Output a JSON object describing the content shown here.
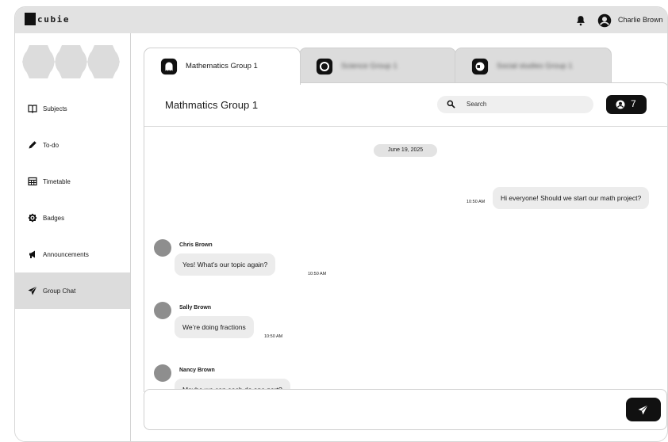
{
  "app": {
    "logo_text": "cubie"
  },
  "user": {
    "name": "Charlie Brown"
  },
  "sidebar": {
    "items": [
      {
        "label": "Subjects",
        "icon": "book-icon"
      },
      {
        "label": "To-do",
        "icon": "pencil-icon"
      },
      {
        "label": "Timetable",
        "icon": "calendar-grid-icon"
      },
      {
        "label": "Badges",
        "icon": "badge-icon"
      },
      {
        "label": "Announcements",
        "icon": "megaphone-icon"
      },
      {
        "label": "Group Chat",
        "icon": "paper-plane-icon",
        "active": true
      }
    ]
  },
  "tabs": [
    {
      "label": "Mathematics Group 1",
      "active": true
    },
    {
      "label": "Science Group 1",
      "active": false
    },
    {
      "label": "Social studies Group 1",
      "active": false
    }
  ],
  "chat": {
    "title": "Mathmatics Group 1",
    "search_placeholder": "Search",
    "member_count": "7",
    "date": "June 19, 2025",
    "messages": [
      {
        "sender": "",
        "text": "Hi everyone! Should we start our math project?",
        "time": "10:50 AM",
        "own": true
      },
      {
        "sender": "Chris Brown",
        "text": "Yes! What’s our topic again?",
        "time": "10:50 AM",
        "own": false
      },
      {
        "sender": "Sally Brown",
        "text": "We’re doing fractions",
        "time": "10:50 AM",
        "own": false
      },
      {
        "sender": "Nancy Brown",
        "text": "Maybe we can each do one part?",
        "time": "",
        "own": false
      }
    ]
  },
  "composer": {
    "placeholder": ""
  },
  "colors": {
    "accent": "#111111",
    "topbar": "#e2e2e2",
    "active_nav": "#dcdcdc",
    "bubble": "#ececec"
  }
}
